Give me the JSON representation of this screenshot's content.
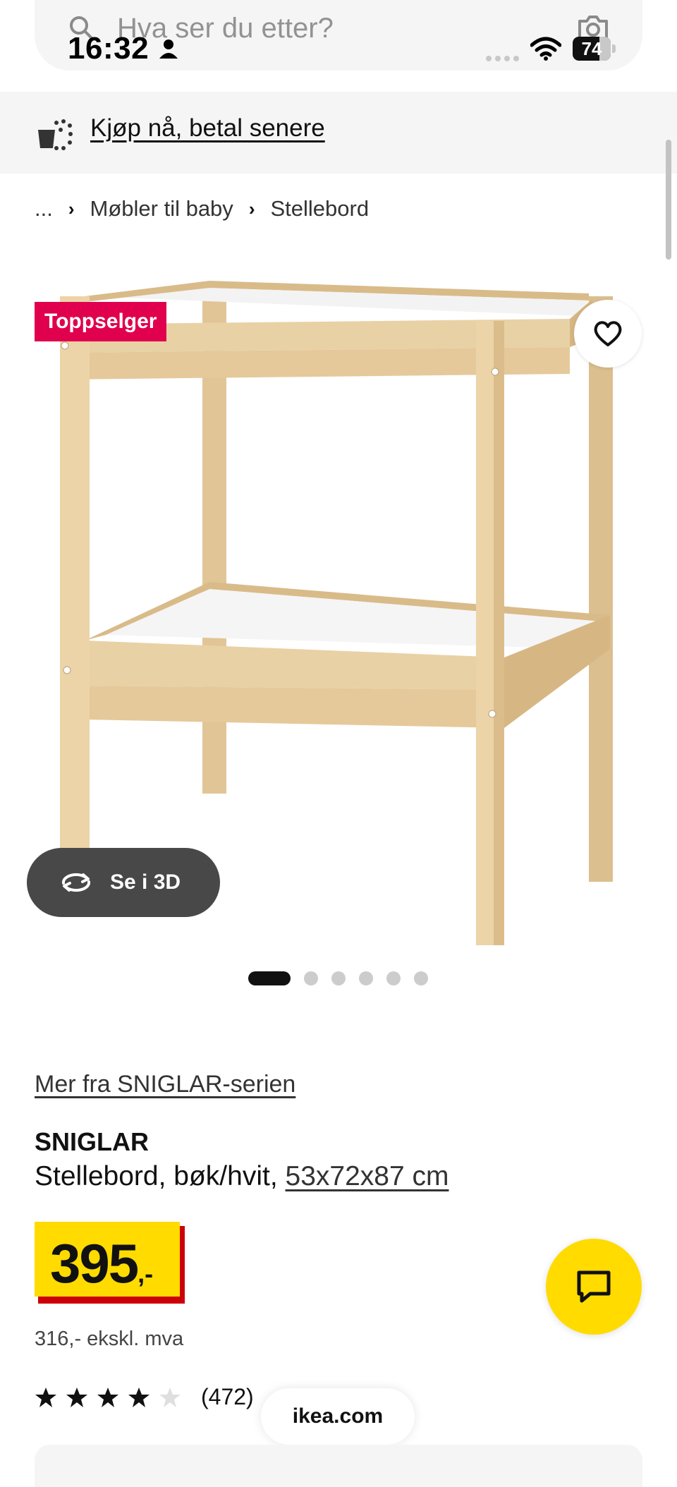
{
  "status_bar": {
    "time": "16:32",
    "battery_level": "74"
  },
  "search": {
    "placeholder": "Hva ser du etter?"
  },
  "banner": {
    "bnpl_label": "Kjøp nå, betal senere"
  },
  "breadcrumb": {
    "items": [
      "...",
      "Møbler til baby",
      "Stellebord"
    ]
  },
  "product": {
    "badge": "Toppselger",
    "see_3d_label": "Se i 3D",
    "carousel": {
      "count": 6,
      "active_index": 0
    },
    "series_link": "Mer fra SNIGLAR-serien",
    "name": "SNIGLAR",
    "description": "Stellebord, bøk/hvit, ",
    "size_link": "53x72x87 cm",
    "price_main": "395",
    "price_suffix": ",-",
    "price_ex_vat": "316,- ekskl. mva",
    "rating": {
      "stars": 4,
      "max": 5,
      "count_label": "(472)"
    }
  },
  "browser": {
    "url": "ikea.com"
  },
  "colors": {
    "badge_red": "#e0004d",
    "price_yellow": "#ffdb00",
    "price_shadow_red": "#cc0008",
    "chat_yellow": "#ffdb00"
  },
  "icons": [
    "search-icon",
    "camera-icon",
    "person-icon",
    "wifi-icon",
    "bnpl-icon",
    "chevron-right-icon",
    "heart-icon",
    "rotate-3d-icon",
    "star-icon",
    "chat-icon"
  ]
}
